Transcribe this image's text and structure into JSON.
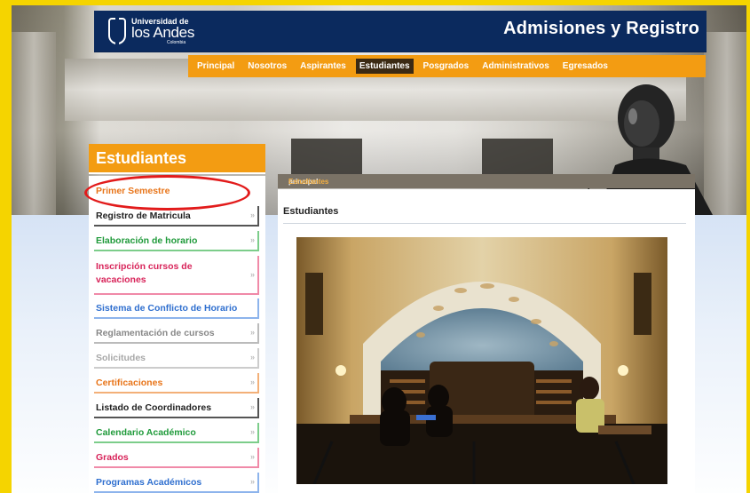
{
  "site": {
    "logo_line1": "Universidad de",
    "logo_line2": "los Andes",
    "logo_line3": "Colombia",
    "title": "Admisiones y Registro"
  },
  "nav": {
    "items": [
      {
        "label": "Principal",
        "active": false
      },
      {
        "label": "Nosotros",
        "active": false
      },
      {
        "label": "Aspirantes",
        "active": false
      },
      {
        "label": "Estudiantes",
        "active": true
      },
      {
        "label": "Posgrados",
        "active": false
      },
      {
        "label": "Administrativos",
        "active": false
      },
      {
        "label": "Egresados",
        "active": false
      }
    ]
  },
  "sidebar": {
    "title": "Estudiantes",
    "items": [
      {
        "label": "Primer Semestre",
        "color": "#e8751a",
        "highlighted": true
      },
      {
        "label": "Registro de Matricula",
        "color": "#222222"
      },
      {
        "label": "Elaboración de horario",
        "color": "#1f9a3a"
      },
      {
        "label": "Inscripción cursos de vacaciones",
        "color": "#d8245a"
      },
      {
        "label": "Sistema de Conflicto de Horario",
        "color": "#2f6fcf"
      },
      {
        "label": "Reglamentación de cursos",
        "color": "#888888"
      },
      {
        "label": "Solicitudes",
        "color": "#a8a8a8"
      },
      {
        "label": "Certificaciones",
        "color": "#e8751a"
      },
      {
        "label": "Listado de Coordinadores",
        "color": "#222222"
      },
      {
        "label": "Calendario Académico",
        "color": "#1f9a3a"
      },
      {
        "label": "Grados",
        "color": "#d8245a"
      },
      {
        "label": "Programas Académicos",
        "color": "#2f6fcf"
      }
    ]
  },
  "breadcrumb": {
    "root": "principal",
    "separator": " - ",
    "current": "Estudiantes"
  },
  "main": {
    "heading": "Estudiantes",
    "photo_icon": "library-reading-room-photo"
  },
  "colors": {
    "accent": "#f39c12",
    "brand_navy": "#0b2a5e",
    "annotation_red": "#e21b1b",
    "outer_frame": "#f5d400"
  }
}
